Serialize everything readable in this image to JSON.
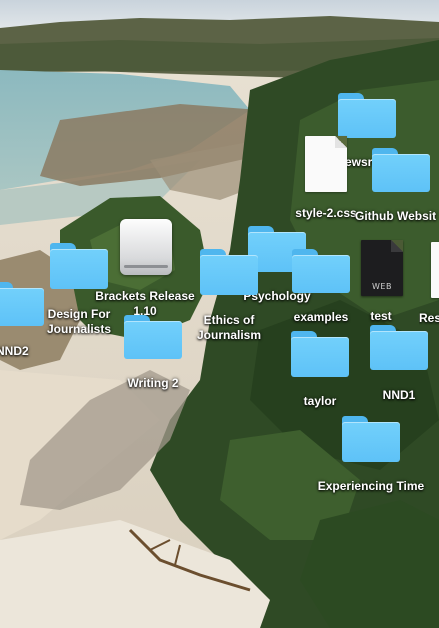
{
  "desktop": {
    "items": [
      {
        "label": "Newsroom",
        "kind": "folder",
        "icon": "folder-icon"
      },
      {
        "label": "style-2.css",
        "kind": "document",
        "icon": "css-file-icon"
      },
      {
        "label": "Github Websit",
        "kind": "folder",
        "icon": "folder-icon"
      },
      {
        "label": "Brackets Release 1.10",
        "kind": "disk-image",
        "icon": "disk-image-icon"
      },
      {
        "label": "Psychology",
        "kind": "folder",
        "icon": "folder-icon"
      },
      {
        "label": "examples",
        "kind": "folder",
        "icon": "folder-icon"
      },
      {
        "label": "test",
        "kind": "web-document",
        "icon": "web-file-icon",
        "badge": "WEB"
      },
      {
        "label": "Res",
        "kind": "file",
        "icon": "file-icon"
      },
      {
        "label": "Design For Journalists",
        "kind": "folder",
        "icon": "folder-icon"
      },
      {
        "label": "Ethics of Journalism",
        "kind": "folder",
        "icon": "folder-icon"
      },
      {
        "label": "NND2",
        "kind": "folder",
        "icon": "folder-icon"
      },
      {
        "label": "Writing 2",
        "kind": "folder",
        "icon": "folder-icon"
      },
      {
        "label": "taylor",
        "kind": "folder",
        "icon": "folder-icon"
      },
      {
        "label": "NND1",
        "kind": "folder",
        "icon": "folder-icon"
      },
      {
        "label": "Experiencing Time",
        "kind": "folder",
        "icon": "folder-icon"
      }
    ]
  },
  "colors": {
    "folder": "#66c6f8",
    "folder_tab": "#4fb6ee",
    "label": "#ffffff"
  }
}
